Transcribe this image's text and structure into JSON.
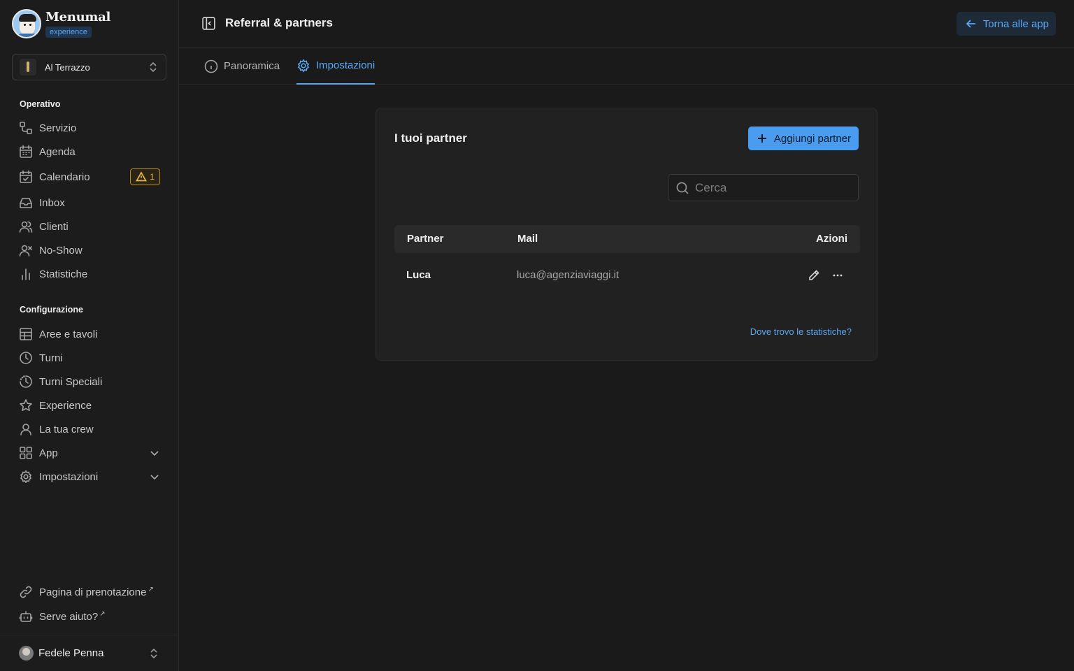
{
  "brand": {
    "name": "Menumal",
    "badge": "experience"
  },
  "venue": {
    "name": "Al Terrazzo"
  },
  "sidebar": {
    "sections": [
      {
        "title": "Operativo"
      },
      {
        "title": "Configurazione"
      }
    ],
    "operativo": [
      {
        "label": "Servizio",
        "icon": "service-icon"
      },
      {
        "label": "Agenda",
        "icon": "calendar-icon"
      },
      {
        "label": "Calendario",
        "icon": "calendar-check-icon",
        "badge": "1"
      },
      {
        "label": "Inbox",
        "icon": "inbox-icon"
      },
      {
        "label": "Clienti",
        "icon": "users-icon"
      },
      {
        "label": "No-Show",
        "icon": "user-x-icon"
      },
      {
        "label": "Statistiche",
        "icon": "bar-chart-icon"
      }
    ],
    "configurazione": [
      {
        "label": "Aree e tavoli",
        "icon": "table-icon"
      },
      {
        "label": "Turni",
        "icon": "clock-icon"
      },
      {
        "label": "Turni Speciali",
        "icon": "clock-dashed-icon"
      },
      {
        "label": "Experience",
        "icon": "star-icon"
      },
      {
        "label": "La tua crew",
        "icon": "user-icon"
      },
      {
        "label": "App",
        "icon": "grid-icon"
      },
      {
        "label": "Impostazioni",
        "icon": "gear-icon"
      }
    ],
    "footer": [
      {
        "label": "Pagina di prenotazione",
        "icon": "link-icon",
        "external": "↗"
      },
      {
        "label": "Serve aiuto?",
        "icon": "bot-icon",
        "external": "↗"
      }
    ],
    "user": {
      "name": "Fedele Penna"
    }
  },
  "header": {
    "title": "Referral & partners",
    "back_label": "Torna alle app"
  },
  "tabs": [
    {
      "label": "Panoramica",
      "icon": "info-icon",
      "active": false
    },
    {
      "label": "Impostazioni",
      "icon": "gear-icon",
      "active": true
    }
  ],
  "card": {
    "title": "I tuoi partner",
    "add_label": "Aggiungi partner",
    "search_placeholder": "Cerca",
    "search_value": "",
    "columns": [
      "Partner",
      "Mail",
      "Azioni"
    ],
    "rows": [
      {
        "partner": "Luca",
        "mail": "luca@agenziaviaggi.it"
      }
    ],
    "stats_link": "Dove trovo le statistiche?"
  },
  "colors": {
    "accent": "#4a9cf0",
    "warning": "#e8b64a",
    "background": "#1a1a1a"
  }
}
